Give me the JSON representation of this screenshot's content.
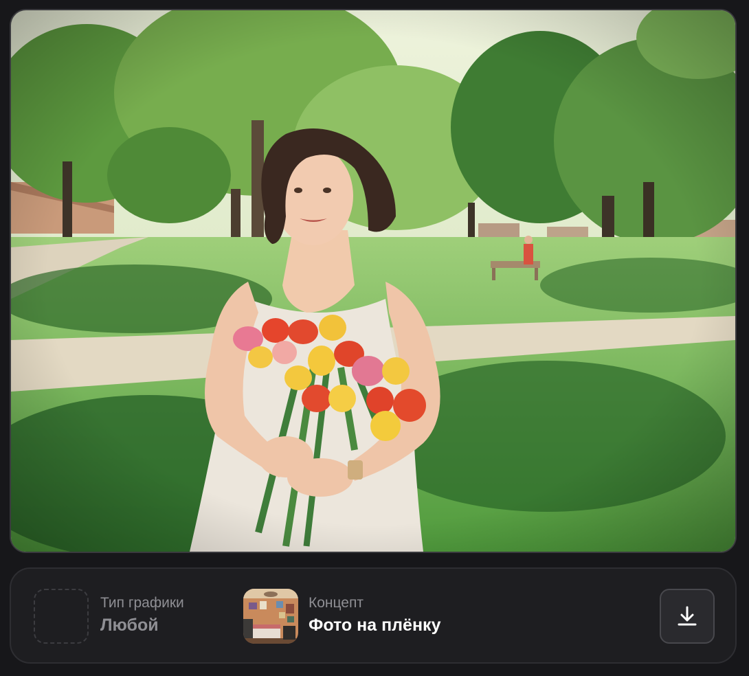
{
  "image": {
    "description_icon": "generated-photo"
  },
  "info_bar": {
    "graphic_type": {
      "label": "Тип графики",
      "value": "Любой"
    },
    "concept": {
      "label": "Концепт",
      "value": "Фото на плёнку",
      "thumb_icon": "room-photo-thumbnail"
    },
    "download_icon": "download-icon"
  },
  "colors": {
    "background": "#17171a",
    "panel": "#1e1e21",
    "muted_text": "#8f8f94",
    "primary_text": "#ffffff"
  }
}
